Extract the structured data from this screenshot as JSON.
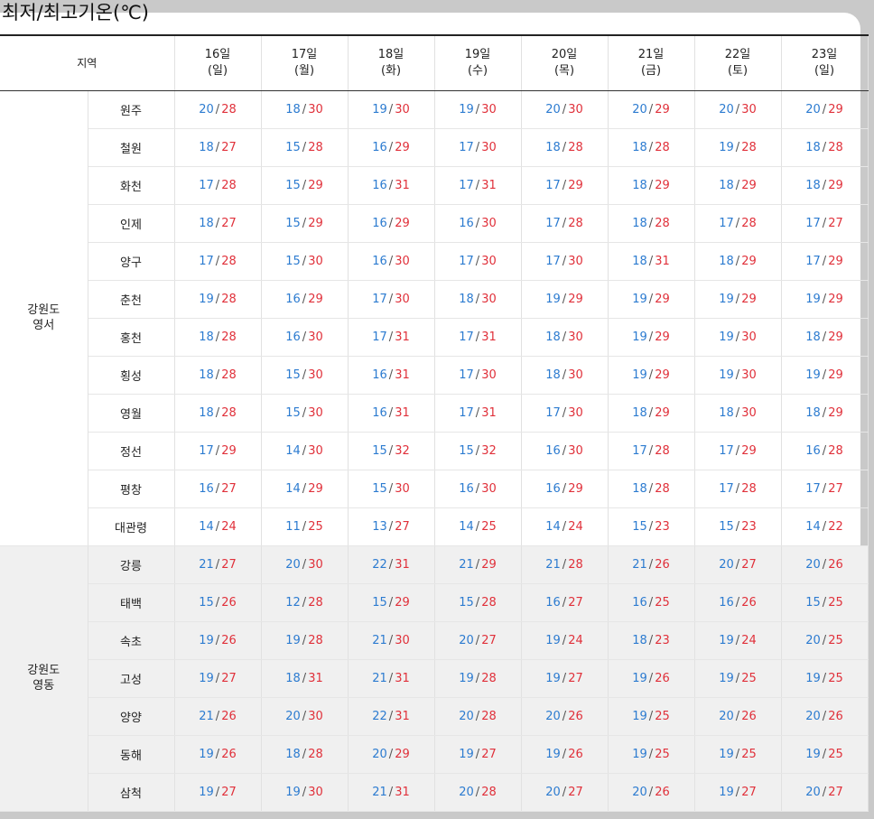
{
  "page": {
    "title": "최저/최고기온(℃)"
  },
  "header": {
    "region_label": "지역",
    "days": [
      {
        "date": "16일",
        "weekday": "(일)"
      },
      {
        "date": "17일",
        "weekday": "(월)"
      },
      {
        "date": "18일",
        "weekday": "(화)"
      },
      {
        "date": "19일",
        "weekday": "(수)"
      },
      {
        "date": "20일",
        "weekday": "(목)"
      },
      {
        "date": "21일",
        "weekday": "(금)"
      },
      {
        "date": "22일",
        "weekday": "(토)"
      },
      {
        "date": "23일",
        "weekday": "(일)"
      }
    ]
  },
  "separator": "/",
  "colors": {
    "low": "#2c7bd0",
    "high": "#e0303a",
    "group2_bg": "#f0f0f0",
    "rule": "#222222"
  },
  "groups": [
    {
      "name_line1": "강원도",
      "name_line2": "영서",
      "rows": [
        {
          "location": "원주",
          "temps": [
            [
              "20",
              "28"
            ],
            [
              "18",
              "30"
            ],
            [
              "19",
              "30"
            ],
            [
              "19",
              "30"
            ],
            [
              "20",
              "30"
            ],
            [
              "20",
              "29"
            ],
            [
              "20",
              "30"
            ],
            [
              "20",
              "29"
            ]
          ]
        },
        {
          "location": "철원",
          "temps": [
            [
              "18",
              "27"
            ],
            [
              "15",
              "28"
            ],
            [
              "16",
              "29"
            ],
            [
              "17",
              "30"
            ],
            [
              "18",
              "28"
            ],
            [
              "18",
              "28"
            ],
            [
              "19",
              "28"
            ],
            [
              "18",
              "28"
            ]
          ]
        },
        {
          "location": "화천",
          "temps": [
            [
              "17",
              "28"
            ],
            [
              "15",
              "29"
            ],
            [
              "16",
              "31"
            ],
            [
              "17",
              "31"
            ],
            [
              "17",
              "29"
            ],
            [
              "18",
              "29"
            ],
            [
              "18",
              "29"
            ],
            [
              "18",
              "29"
            ]
          ]
        },
        {
          "location": "인제",
          "temps": [
            [
              "18",
              "27"
            ],
            [
              "15",
              "29"
            ],
            [
              "16",
              "29"
            ],
            [
              "16",
              "30"
            ],
            [
              "17",
              "28"
            ],
            [
              "18",
              "28"
            ],
            [
              "17",
              "28"
            ],
            [
              "17",
              "27"
            ]
          ]
        },
        {
          "location": "양구",
          "temps": [
            [
              "17",
              "28"
            ],
            [
              "15",
              "30"
            ],
            [
              "16",
              "30"
            ],
            [
              "17",
              "30"
            ],
            [
              "17",
              "30"
            ],
            [
              "18",
              "31"
            ],
            [
              "18",
              "29"
            ],
            [
              "17",
              "29"
            ]
          ]
        },
        {
          "location": "춘천",
          "temps": [
            [
              "19",
              "28"
            ],
            [
              "16",
              "29"
            ],
            [
              "17",
              "30"
            ],
            [
              "18",
              "30"
            ],
            [
              "19",
              "29"
            ],
            [
              "19",
              "29"
            ],
            [
              "19",
              "29"
            ],
            [
              "19",
              "29"
            ]
          ]
        },
        {
          "location": "홍천",
          "temps": [
            [
              "18",
              "28"
            ],
            [
              "16",
              "30"
            ],
            [
              "17",
              "31"
            ],
            [
              "17",
              "31"
            ],
            [
              "18",
              "30"
            ],
            [
              "19",
              "29"
            ],
            [
              "19",
              "30"
            ],
            [
              "18",
              "29"
            ]
          ]
        },
        {
          "location": "횡성",
          "temps": [
            [
              "18",
              "28"
            ],
            [
              "15",
              "30"
            ],
            [
              "16",
              "31"
            ],
            [
              "17",
              "30"
            ],
            [
              "18",
              "30"
            ],
            [
              "19",
              "29"
            ],
            [
              "19",
              "30"
            ],
            [
              "19",
              "29"
            ]
          ]
        },
        {
          "location": "영월",
          "temps": [
            [
              "18",
              "28"
            ],
            [
              "15",
              "30"
            ],
            [
              "16",
              "31"
            ],
            [
              "17",
              "31"
            ],
            [
              "17",
              "30"
            ],
            [
              "18",
              "29"
            ],
            [
              "18",
              "30"
            ],
            [
              "18",
              "29"
            ]
          ]
        },
        {
          "location": "정선",
          "temps": [
            [
              "17",
              "29"
            ],
            [
              "14",
              "30"
            ],
            [
              "15",
              "32"
            ],
            [
              "15",
              "32"
            ],
            [
              "16",
              "30"
            ],
            [
              "17",
              "28"
            ],
            [
              "17",
              "29"
            ],
            [
              "16",
              "28"
            ]
          ]
        },
        {
          "location": "평창",
          "temps": [
            [
              "16",
              "27"
            ],
            [
              "14",
              "29"
            ],
            [
              "15",
              "30"
            ],
            [
              "16",
              "30"
            ],
            [
              "16",
              "29"
            ],
            [
              "18",
              "28"
            ],
            [
              "17",
              "28"
            ],
            [
              "17",
              "27"
            ]
          ]
        },
        {
          "location": "대관령",
          "temps": [
            [
              "14",
              "24"
            ],
            [
              "11",
              "25"
            ],
            [
              "13",
              "27"
            ],
            [
              "14",
              "25"
            ],
            [
              "14",
              "24"
            ],
            [
              "15",
              "23"
            ],
            [
              "15",
              "23"
            ],
            [
              "14",
              "22"
            ]
          ]
        }
      ]
    },
    {
      "name_line1": "강원도",
      "name_line2": "영동",
      "rows": [
        {
          "location": "강릉",
          "temps": [
            [
              "21",
              "27"
            ],
            [
              "20",
              "30"
            ],
            [
              "22",
              "31"
            ],
            [
              "21",
              "29"
            ],
            [
              "21",
              "28"
            ],
            [
              "21",
              "26"
            ],
            [
              "20",
              "27"
            ],
            [
              "20",
              "26"
            ]
          ]
        },
        {
          "location": "태백",
          "temps": [
            [
              "15",
              "26"
            ],
            [
              "12",
              "28"
            ],
            [
              "15",
              "29"
            ],
            [
              "15",
              "28"
            ],
            [
              "16",
              "27"
            ],
            [
              "16",
              "25"
            ],
            [
              "16",
              "26"
            ],
            [
              "15",
              "25"
            ]
          ]
        },
        {
          "location": "속초",
          "temps": [
            [
              "19",
              "26"
            ],
            [
              "19",
              "28"
            ],
            [
              "21",
              "30"
            ],
            [
              "20",
              "27"
            ],
            [
              "19",
              "24"
            ],
            [
              "18",
              "23"
            ],
            [
              "19",
              "24"
            ],
            [
              "20",
              "25"
            ]
          ]
        },
        {
          "location": "고성",
          "temps": [
            [
              "19",
              "27"
            ],
            [
              "18",
              "31"
            ],
            [
              "21",
              "31"
            ],
            [
              "19",
              "28"
            ],
            [
              "19",
              "27"
            ],
            [
              "19",
              "26"
            ],
            [
              "19",
              "25"
            ],
            [
              "19",
              "25"
            ]
          ]
        },
        {
          "location": "양양",
          "temps": [
            [
              "21",
              "26"
            ],
            [
              "20",
              "30"
            ],
            [
              "22",
              "31"
            ],
            [
              "20",
              "28"
            ],
            [
              "20",
              "26"
            ],
            [
              "19",
              "25"
            ],
            [
              "20",
              "26"
            ],
            [
              "20",
              "26"
            ]
          ]
        },
        {
          "location": "동해",
          "temps": [
            [
              "19",
              "26"
            ],
            [
              "18",
              "28"
            ],
            [
              "20",
              "29"
            ],
            [
              "19",
              "27"
            ],
            [
              "19",
              "26"
            ],
            [
              "19",
              "25"
            ],
            [
              "19",
              "25"
            ],
            [
              "19",
              "25"
            ]
          ]
        },
        {
          "location": "삼척",
          "temps": [
            [
              "19",
              "27"
            ],
            [
              "19",
              "30"
            ],
            [
              "21",
              "31"
            ],
            [
              "20",
              "28"
            ],
            [
              "20",
              "27"
            ],
            [
              "20",
              "26"
            ],
            [
              "19",
              "27"
            ],
            [
              "20",
              "27"
            ]
          ]
        }
      ]
    }
  ]
}
